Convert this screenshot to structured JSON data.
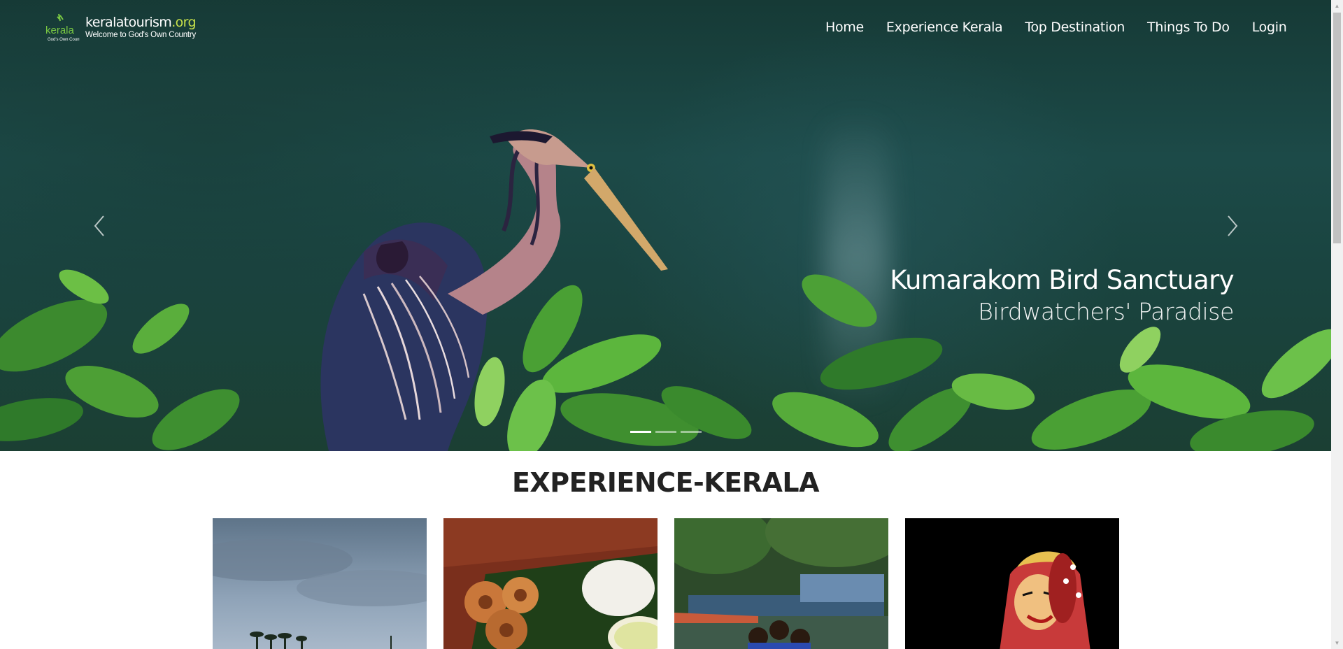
{
  "brand": {
    "logo_word": "kerala",
    "logo_sub": "’s Own Country",
    "site_name_main": "keralatourism",
    "site_name_tld": ".org",
    "tagline": "Welcome to God's Own Country"
  },
  "nav": {
    "items": [
      {
        "label": "Home"
      },
      {
        "label": "Experience Kerala"
      },
      {
        "label": "Top Destination"
      },
      {
        "label": "Things To Do"
      },
      {
        "label": "Login"
      }
    ]
  },
  "carousel": {
    "slide_title": "Kumarakom Bird Sanctuary",
    "slide_subtitle": "Birdwatchers' Paradise",
    "slide_count": 3,
    "active_slide": 1,
    "prev_icon": "chevron-left-icon",
    "next_icon": "chevron-right-icon"
  },
  "section": {
    "title": "EXPERIENCE-KERALA",
    "cards": [
      {
        "image": "backwaters-sky-palms"
      },
      {
        "image": "kerala-snacks-appam"
      },
      {
        "image": "snake-boat-rowers"
      },
      {
        "image": "kathakali-dancer"
      }
    ]
  },
  "colors": {
    "accent_tld": "#c7e04a",
    "hero_bg": "#1c4a48",
    "title_text": "#222222"
  }
}
